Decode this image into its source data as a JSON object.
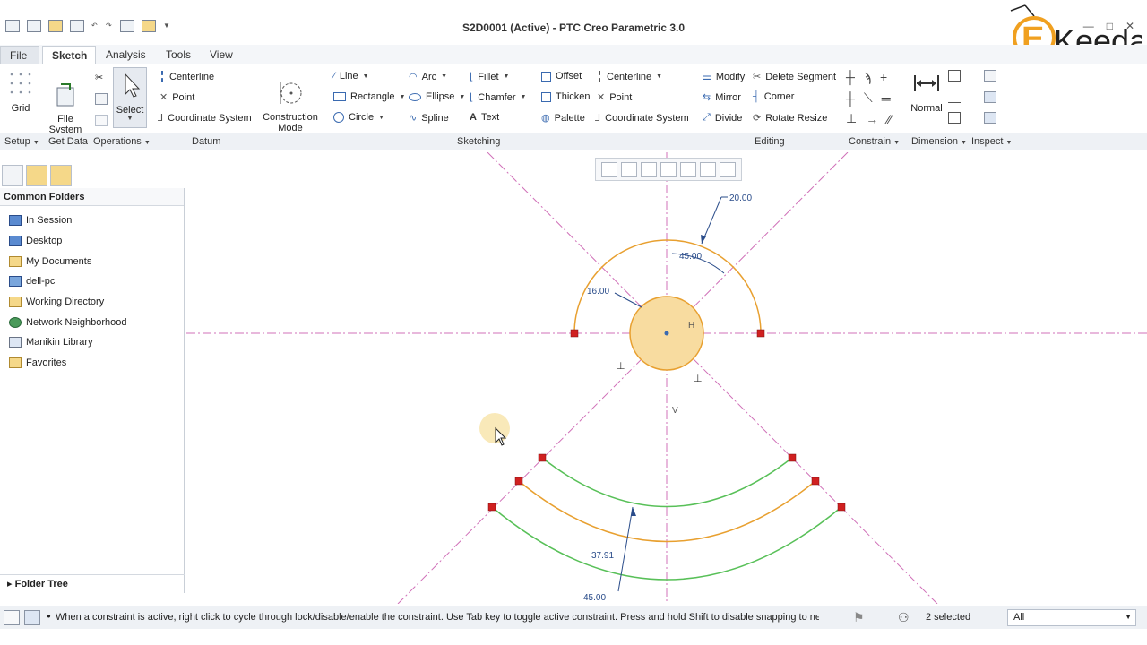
{
  "window": {
    "title": "S2D0001 (Active) - PTC Creo Parametric 3.0"
  },
  "logo": {
    "text": "Keeda"
  },
  "tabs": [
    {
      "label": "File"
    },
    {
      "label": "Sketch"
    },
    {
      "label": "Analysis"
    },
    {
      "label": "Tools"
    },
    {
      "label": "View"
    }
  ],
  "ribbon": {
    "grid": "Grid",
    "file_system": "File\nSystem",
    "select": "Select",
    "datum_centerline": "Centerline",
    "datum_point": "Point",
    "datum_coord": "Coordinate System",
    "construction_mode": "Construction\nMode",
    "line": "Line",
    "rectangle": "Rectangle",
    "circle": "Circle",
    "arc": "Arc",
    "ellipse": "Ellipse",
    "spline": "Spline",
    "fillet": "Fillet",
    "chamfer": "Chamfer",
    "text": "Text",
    "offset": "Offset",
    "thicken": "Thicken",
    "palette": "Palette",
    "sk_centerline": "Centerline",
    "sk_point": "Point",
    "sk_coord": "Coordinate System",
    "modify": "Modify",
    "mirror": "Mirror",
    "divide": "Divide",
    "delete_segment": "Delete Segment",
    "corner": "Corner",
    "rotate_resize": "Rotate Resize",
    "normal": "Normal"
  },
  "groups": [
    {
      "label": "Setup"
    },
    {
      "label": "Get Data"
    },
    {
      "label": "Operations"
    },
    {
      "label": "Datum"
    },
    {
      "label": "Sketching"
    },
    {
      "label": "Editing"
    },
    {
      "label": "Constrain"
    },
    {
      "label": "Dimension"
    },
    {
      "label": "Inspect"
    }
  ],
  "panel": {
    "header": "Common Folders",
    "folders": [
      {
        "label": "In Session"
      },
      {
        "label": "Desktop"
      },
      {
        "label": "My Documents"
      },
      {
        "label": "dell-pc"
      },
      {
        "label": "Working Directory"
      },
      {
        "label": "Network Neighborhood"
      },
      {
        "label": "Manikin Library"
      },
      {
        "label": "Favorites"
      }
    ],
    "folder_tree": "Folder Tree"
  },
  "sketch": {
    "dims": {
      "d20": "20.00",
      "d45a": "45.00",
      "d16": "16.00",
      "d3791": "37.91",
      "d45b": "45.00"
    },
    "labels": {
      "h": "H",
      "v": "V"
    },
    "colors": {
      "centerline": "#d070b8",
      "arc_orange": "#e8a030",
      "arc_green": "#58c058",
      "circle_fill": "#f8dca0",
      "dim": "#2a4c8a",
      "point": "#d02020"
    }
  },
  "status": {
    "message": "When a constraint is active, right click to cycle through lock/disable/enable the constraint. Use Tab key to toggle active constraint. Press and hold Shift to disable snapping to new constrai",
    "selected": "2 selected",
    "filter": "All"
  }
}
